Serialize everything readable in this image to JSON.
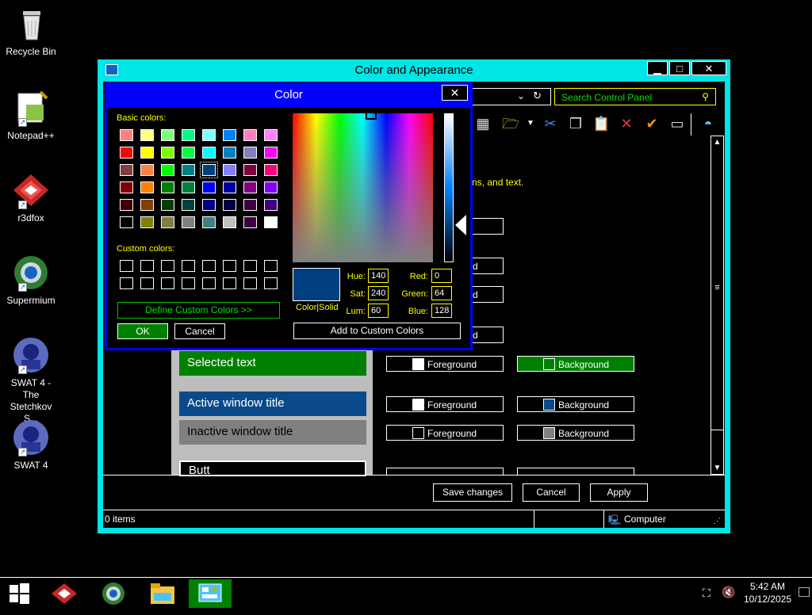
{
  "desktop": {
    "icons": [
      {
        "label": "Recycle Bin",
        "icon": "recycle-bin-icon"
      },
      {
        "label": "Notepad++",
        "icon": "notepad-icon"
      },
      {
        "label": "r3dfox",
        "icon": "r3dfox-icon"
      },
      {
        "label": "Supermium",
        "icon": "supermium-icon"
      },
      {
        "label": "SWAT 4 - The Stetchkov S...",
        "icon": "swat4-icon"
      },
      {
        "label": "SWAT 4",
        "icon": "swat4-icon"
      }
    ]
  },
  "window": {
    "title": "Color and Appearance",
    "search_placeholder": "Search Control Panel",
    "intro_text": "ns, and text.",
    "samples": {
      "selected_text": "Selected text",
      "active_title": "Active window title",
      "inactive_title": "Inactive window title",
      "button": "Butt"
    },
    "fg_label": "Foreground",
    "bg_label": "Background",
    "partial_d": "d",
    "buttons": {
      "save": "Save changes",
      "cancel": "Cancel",
      "apply": "Apply"
    },
    "status": {
      "items": "0 items",
      "location": "Computer"
    },
    "colors": {
      "accent": "#00e5e5",
      "selected_green": "#008000",
      "active_blue": "#0a4a8a",
      "inactive_gray": "#808080"
    }
  },
  "dialog": {
    "title": "Color",
    "basic_label": "Basic colors:",
    "custom_label": "Custom colors:",
    "define_custom": "Define Custom Colors >>",
    "ok": "OK",
    "cancel": "Cancel",
    "color_solid": "Color|Solid",
    "add_custom": "Add to Custom Colors",
    "fields": {
      "hue_label": "Hue:",
      "hue": "140",
      "sat_label": "Sat:",
      "sat": "240",
      "lum_label": "Lum:",
      "lum": "60",
      "red_label": "Red:",
      "red": "0",
      "green_label": "Green:",
      "green": "64",
      "blue_label": "Blue:",
      "blue": "128"
    },
    "selected_color": "#004080",
    "basic_colors": [
      "#ff8080",
      "#ffff80",
      "#80ff80",
      "#00ff80",
      "#80ffff",
      "#0080ff",
      "#ff80c0",
      "#ff80ff",
      "#ff0000",
      "#ffff00",
      "#80ff00",
      "#00ff40",
      "#00ffff",
      "#0080c0",
      "#8080c0",
      "#ff00ff",
      "#804040",
      "#ff8040",
      "#00ff00",
      "#008080",
      "#004080",
      "#8080ff",
      "#800040",
      "#ff0080",
      "#800000",
      "#ff8000",
      "#008000",
      "#008040",
      "#0000ff",
      "#0000a0",
      "#800080",
      "#8000ff",
      "#400000",
      "#804000",
      "#004000",
      "#004040",
      "#000080",
      "#000040",
      "#400040",
      "#400080",
      "#000000",
      "#808000",
      "#808040",
      "#808080",
      "#408080",
      "#c0c0c0",
      "#400040",
      "#ffffff"
    ]
  },
  "taskbar": {
    "time": "5:42 AM",
    "date": "10/12/2025",
    "apps": [
      "r3dfox-icon",
      "supermium-icon",
      "file-explorer-icon",
      "control-panel-icon"
    ]
  }
}
